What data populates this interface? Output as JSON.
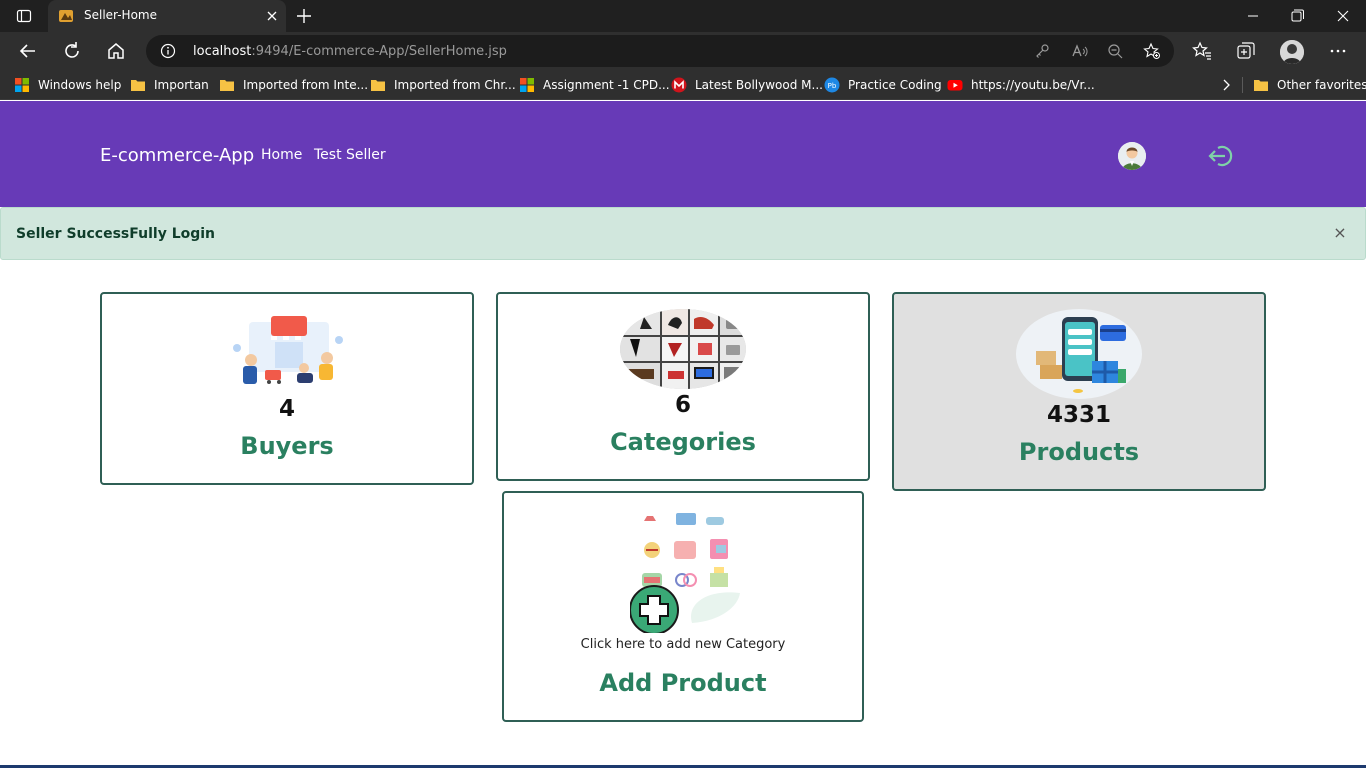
{
  "browser": {
    "tab_title": "Seller-Home",
    "url_host": "localhost",
    "url_rest": ":9494/E-commerce-App/SellerHome.jsp",
    "bookmarks": [
      {
        "label": "Windows help",
        "icon": "windows-logo-icon"
      },
      {
        "label": "Importan",
        "icon": "folder-icon"
      },
      {
        "label": "Imported from Inte...",
        "icon": "folder-icon"
      },
      {
        "label": "Imported from Chr...",
        "icon": "folder-icon"
      },
      {
        "label": "Assignment -1 CPD...",
        "icon": "windows-logo-icon"
      },
      {
        "label": "Latest Bollywood M...",
        "icon": "red-m-icon"
      },
      {
        "label": "Practice Coding",
        "icon": "pb-icon"
      },
      {
        "label": "https://youtu.be/Vr...",
        "icon": "youtube-icon"
      }
    ],
    "other_favorites": "Other favorites"
  },
  "navbar": {
    "brand": "E-commerce-App",
    "links": [
      "Home",
      "Test Seller"
    ]
  },
  "alert": {
    "message": "Seller SuccessFully Login",
    "close": "×"
  },
  "cards": {
    "buyers": {
      "count": "4",
      "label": "Buyers"
    },
    "categories": {
      "count": "6",
      "label": "Categories"
    },
    "products": {
      "count": "4331",
      "label": "Products"
    },
    "add_product": {
      "note": "Click here to add new Category",
      "label": "Add Product"
    }
  },
  "colors": {
    "navbar": "#673ab7",
    "alert_bg": "#d1e7dd",
    "card_label": "#2a8060",
    "card_border": "#2f5f55"
  }
}
